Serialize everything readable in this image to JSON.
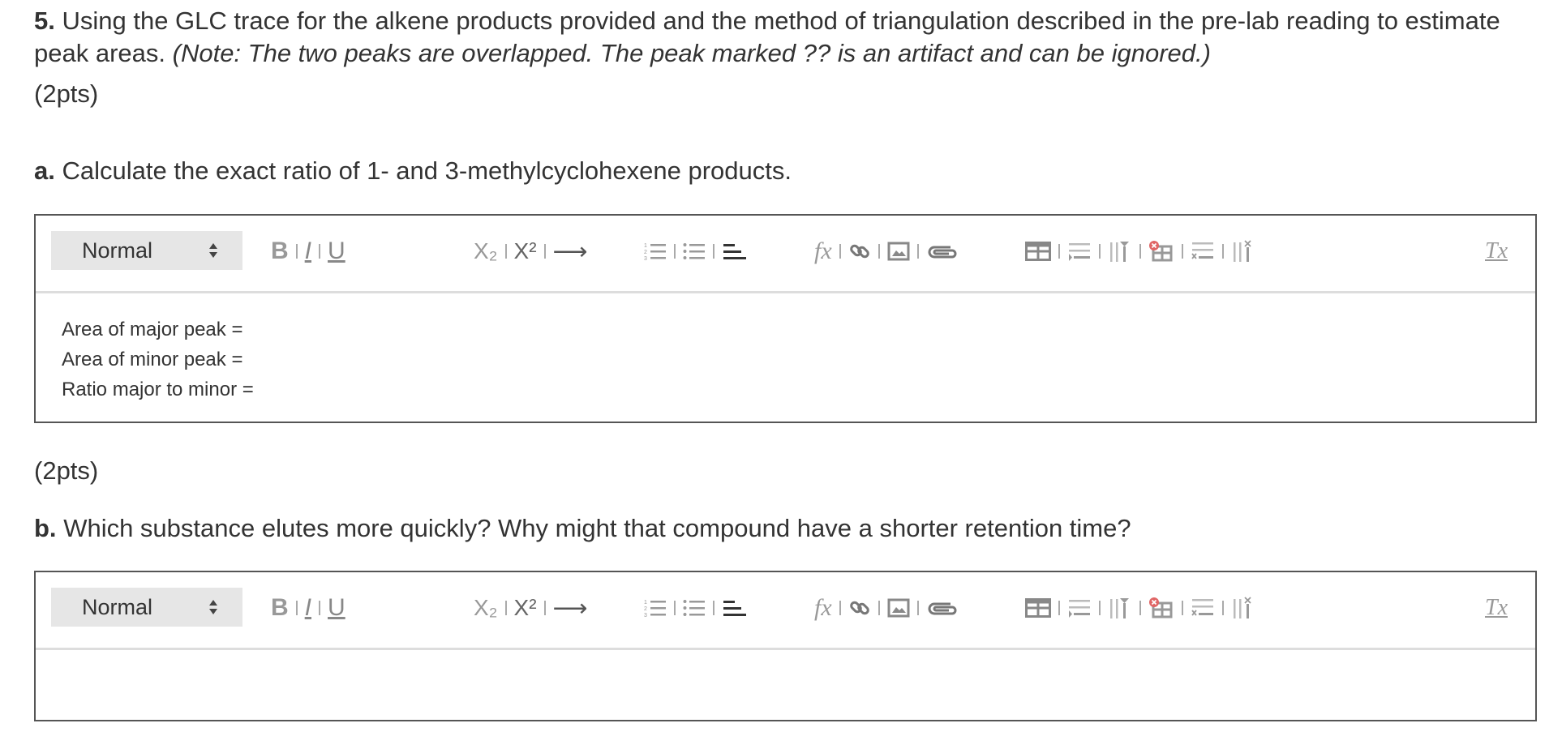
{
  "question": {
    "number": "5.",
    "text": "Using the GLC trace for the alkene products provided and the method of triangulation described in the pre-lab reading to estimate peak areas.",
    "note": "(Note: The two peaks are overlapped. The peak marked ?? is an artifact and can be ignored.)"
  },
  "part_a": {
    "points": "(2pts)",
    "label": "a.",
    "text": "Calculate the exact ratio of 1- and 3-methylcyclohexene products.",
    "editor": {
      "format_select": "Normal",
      "content_lines": [
        "Area of major peak =",
        "Area of minor peak =",
        "Ratio major to minor ="
      ]
    }
  },
  "part_b": {
    "points": "(2pts)",
    "label": "b.",
    "text": "Which substance elutes more quickly? Why might that compound have a shorter retention time?",
    "editor": {
      "format_select": "Normal",
      "content_lines": []
    }
  },
  "toolbar": {
    "bold": "B",
    "italic": "I",
    "underline": "U",
    "subscript": "X₂",
    "superscript": "X²",
    "arrow": "⟶",
    "formula": "fx",
    "clear_format": "Tx",
    "icons": [
      "bold-icon",
      "italic-icon",
      "underline-icon",
      "subscript-icon",
      "superscript-icon",
      "arrow-icon",
      "ordered-list-icon",
      "bullet-list-icon",
      "align-icon",
      "formula-icon",
      "link-icon",
      "image-icon",
      "attachment-icon",
      "table-icon",
      "insert-row-icon",
      "insert-column-icon",
      "delete-table-icon",
      "delete-row-icon",
      "delete-column-icon",
      "clear-format-icon"
    ]
  }
}
